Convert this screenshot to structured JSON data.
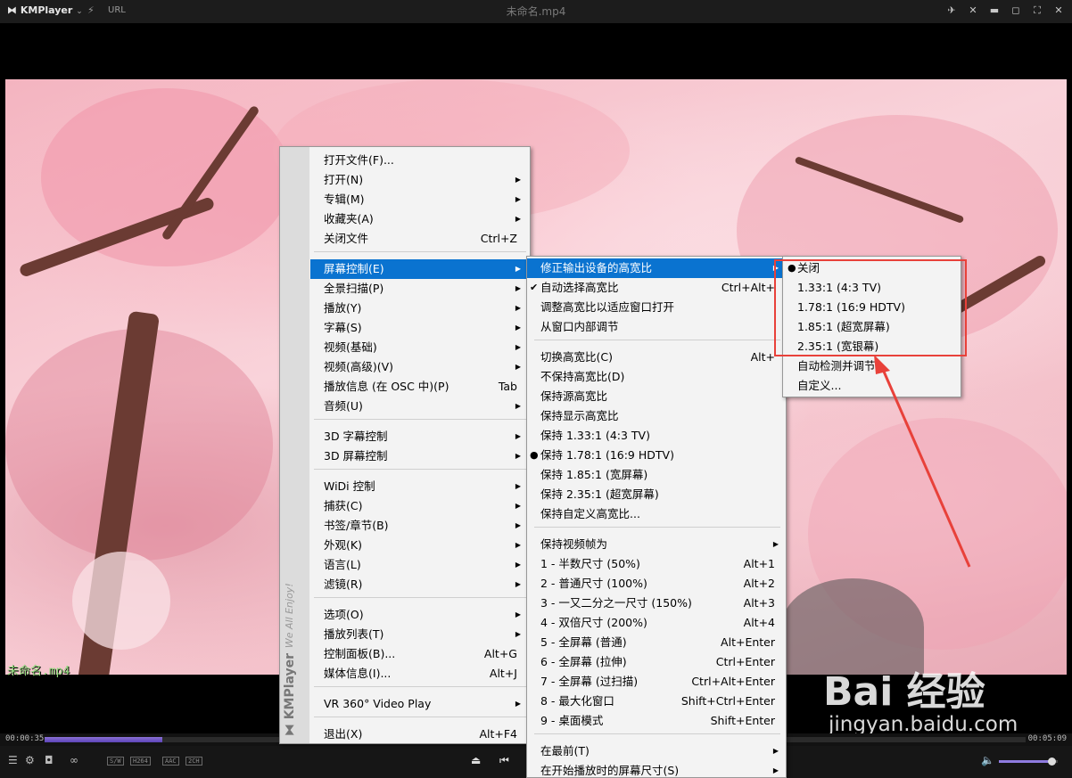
{
  "titlebar": {
    "logo": "KMPlayer",
    "url_label": "URL",
    "window_title": "未命名.mp4"
  },
  "video": {
    "overlay_filename": "未命名.mp4"
  },
  "playback": {
    "elapsed": "00:00:35",
    "total": "00:05:09",
    "progress_fraction": 0.12,
    "volume_fraction": 0.9,
    "tags": [
      "S/W",
      "H264",
      "AAC",
      "2CH"
    ]
  },
  "watermark": {
    "main": "Bai 经验",
    "sub": "jingyan.baidu.com"
  },
  "sidebar": {
    "brand": "KMPlayer",
    "tagline": "We All Enjoy!"
  },
  "main_menu": {
    "items": [
      {
        "label": "打开文件(F)...",
        "shortcut": "",
        "arrow": false
      },
      {
        "label": "打开(N)",
        "shortcut": "",
        "arrow": true
      },
      {
        "label": "专辑(M)",
        "shortcut": "",
        "arrow": true
      },
      {
        "label": "收藏夹(A)",
        "shortcut": "",
        "arrow": true
      },
      {
        "label": "关闭文件",
        "shortcut": "Ctrl+Z",
        "arrow": false
      },
      {
        "label": "屏幕控制(E)",
        "shortcut": "",
        "arrow": true,
        "selected": true
      },
      {
        "label": "全景扫描(P)",
        "shortcut": "",
        "arrow": true
      },
      {
        "label": "播放(Y)",
        "shortcut": "",
        "arrow": true
      },
      {
        "label": "字幕(S)",
        "shortcut": "",
        "arrow": true
      },
      {
        "label": "视频(基础)",
        "shortcut": "",
        "arrow": true
      },
      {
        "label": "视频(高级)(V)",
        "shortcut": "",
        "arrow": true
      },
      {
        "label": "播放信息 (在 OSC 中)(P)",
        "shortcut": "Tab",
        "arrow": false
      },
      {
        "label": "音频(U)",
        "shortcut": "",
        "arrow": true
      },
      {
        "label": "3D 字幕控制",
        "shortcut": "",
        "arrow": true
      },
      {
        "label": "3D 屏幕控制",
        "shortcut": "",
        "arrow": true
      },
      {
        "label": "WiDi 控制",
        "shortcut": "",
        "arrow": true
      },
      {
        "label": "捕获(C)",
        "shortcut": "",
        "arrow": true
      },
      {
        "label": "书签/章节(B)",
        "shortcut": "",
        "arrow": true
      },
      {
        "label": "外观(K)",
        "shortcut": "",
        "arrow": true
      },
      {
        "label": "语言(L)",
        "shortcut": "",
        "arrow": true
      },
      {
        "label": "滤镜(R)",
        "shortcut": "",
        "arrow": true
      },
      {
        "label": "选项(O)",
        "shortcut": "",
        "arrow": true
      },
      {
        "label": "播放列表(T)",
        "shortcut": "",
        "arrow": true
      },
      {
        "label": "控制面板(B)...",
        "shortcut": "Alt+G",
        "arrow": false
      },
      {
        "label": "媒体信息(I)...",
        "shortcut": "Alt+J",
        "arrow": false
      },
      {
        "label": "VR 360° Video Play",
        "shortcut": "",
        "arrow": true
      },
      {
        "label": "退出(X)",
        "shortcut": "Alt+F4",
        "arrow": false
      }
    ]
  },
  "screen_menu": {
    "items": [
      {
        "label": "修正输出设备的高宽比",
        "shortcut": "",
        "arrow": true,
        "selected": true,
        "mark": ""
      },
      {
        "label": "自动选择高宽比",
        "shortcut": "Ctrl+Alt+",
        "arrow": false,
        "mark": "✔"
      },
      {
        "label": "调整高宽比以适应窗口打开",
        "shortcut": "",
        "arrow": false,
        "mark": ""
      },
      {
        "label": "从窗口内部调节",
        "shortcut": "",
        "arrow": false,
        "mark": ""
      },
      {
        "label": "切换高宽比(C)",
        "shortcut": "Alt+",
        "arrow": false,
        "mark": ""
      },
      {
        "label": "不保持高宽比(D)",
        "shortcut": "",
        "arrow": false,
        "mark": ""
      },
      {
        "label": "保持源高宽比",
        "shortcut": "",
        "arrow": false,
        "mark": ""
      },
      {
        "label": "保持显示高宽比",
        "shortcut": "",
        "arrow": false,
        "mark": ""
      },
      {
        "label": "保持 1.33:1 (4:3 TV)",
        "shortcut": "",
        "arrow": false,
        "mark": ""
      },
      {
        "label": "保持 1.78:1 (16:9 HDTV)",
        "shortcut": "",
        "arrow": false,
        "mark": "●"
      },
      {
        "label": "保持 1.85:1 (宽屏幕)",
        "shortcut": "",
        "arrow": false,
        "mark": ""
      },
      {
        "label": "保持 2.35:1 (超宽屏幕)",
        "shortcut": "",
        "arrow": false,
        "mark": ""
      },
      {
        "label": "保持自定义高宽比...",
        "shortcut": "",
        "arrow": false,
        "mark": ""
      },
      {
        "label": "保持视频帧为",
        "shortcut": "",
        "arrow": true,
        "mark": ""
      },
      {
        "label": "1 - 半数尺寸 (50%)",
        "shortcut": "Alt+1",
        "arrow": false,
        "mark": ""
      },
      {
        "label": "2 - 普通尺寸 (100%)",
        "shortcut": "Alt+2",
        "arrow": false,
        "mark": ""
      },
      {
        "label": "3 - 一又二分之一尺寸 (150%)",
        "shortcut": "Alt+3",
        "arrow": false,
        "mark": ""
      },
      {
        "label": "4 - 双倍尺寸 (200%)",
        "shortcut": "Alt+4",
        "arrow": false,
        "mark": ""
      },
      {
        "label": "5 - 全屏幕 (普通)",
        "shortcut": "Alt+Enter",
        "arrow": false,
        "mark": ""
      },
      {
        "label": "6 - 全屏幕 (拉伸)",
        "shortcut": "Ctrl+Enter",
        "arrow": false,
        "mark": ""
      },
      {
        "label": "7 - 全屏幕 (过扫描)",
        "shortcut": "Ctrl+Alt+Enter",
        "arrow": false,
        "mark": ""
      },
      {
        "label": "8 - 最大化窗口",
        "shortcut": "Shift+Ctrl+Enter",
        "arrow": false,
        "mark": ""
      },
      {
        "label": "9 - 桌面模式",
        "shortcut": "Shift+Enter",
        "arrow": false,
        "mark": ""
      },
      {
        "label": "在最前(T)",
        "shortcut": "",
        "arrow": true,
        "mark": ""
      },
      {
        "label": "在开始播放时的屏幕尺寸(S)",
        "shortcut": "",
        "arrow": true,
        "mark": ""
      }
    ]
  },
  "aspect_menu": {
    "items": [
      {
        "label": "关闭",
        "mark": "●"
      },
      {
        "label": "1.33:1 (4:3 TV)",
        "mark": ""
      },
      {
        "label": "1.78:1 (16:9 HDTV)",
        "mark": ""
      },
      {
        "label": "1.85:1 (超宽屏幕)",
        "mark": ""
      },
      {
        "label": "2.35:1 (宽银幕)",
        "mark": ""
      },
      {
        "label": "自动检测并调节",
        "mark": ""
      },
      {
        "label": "自定义...",
        "mark": ""
      }
    ]
  },
  "colors": {
    "menu_highlight": "#0a73d0",
    "annotation_red": "#e8413a",
    "seek_fill": "#6a52c4"
  }
}
